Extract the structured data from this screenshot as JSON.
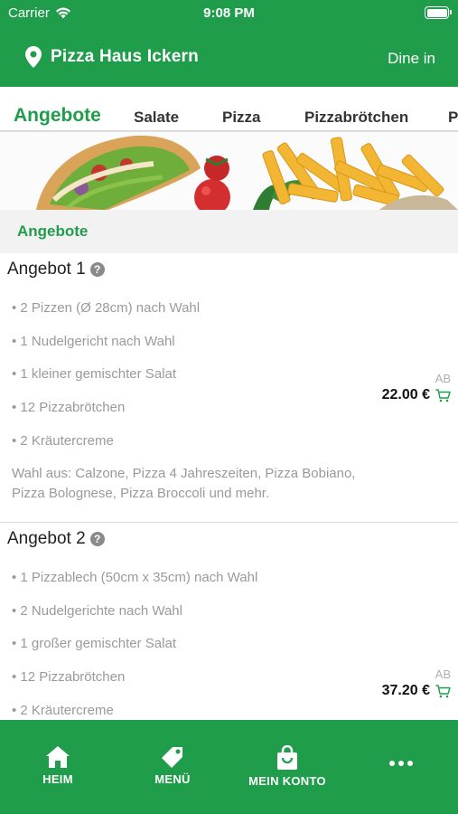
{
  "status_bar": {
    "carrier": "Carrier",
    "time": "9:08 PM"
  },
  "header": {
    "restaurant_name": "Pizza Haus Ickern",
    "mode": "Dine in",
    "icon": "location-pin-icon"
  },
  "tabs": [
    {
      "label": "Angebote",
      "active": true
    },
    {
      "label": "Salate",
      "active": false
    },
    {
      "label": "Pizza",
      "active": false
    },
    {
      "label": "Pizzabrötchen",
      "active": false
    },
    {
      "label": "P",
      "active": false
    }
  ],
  "section": {
    "title": "Angebote"
  },
  "offers": [
    {
      "name": "Angebot 1",
      "items": [
        "• 2 Pizzen (Ø 28cm) nach Wahl",
        "• 1 Nudelgericht nach Wahl",
        "• 1 kleiner gemischter Salat",
        "• 12 Pizzabrötchen",
        "• 2 Kräutercreme"
      ],
      "description": "Wahl aus: Calzone, Pizza 4 Jahreszeiten, Pizza Bobiano, Pizza Bolognese, Pizza Broccoli und mehr.",
      "price_prefix": "AB",
      "price": "22.00 €"
    },
    {
      "name": "Angebot 2",
      "items": [
        "• 1 Pizzablech (50cm x 35cm) nach Wahl",
        "• 2 Nudelgerichte nach Wahl",
        "• 1 großer gemischter Salat",
        "• 12 Pizzabrötchen",
        "• 2 Kräutercreme"
      ],
      "price_prefix": "AB",
      "price": "37.20 €"
    }
  ],
  "bottom_nav": [
    {
      "label": "HEIM",
      "icon": "home-icon"
    },
    {
      "label": "MENÜ",
      "icon": "tag-icon"
    },
    {
      "label": "MEIN KONTO",
      "icon": "shopping-bag-icon"
    },
    {
      "label": "",
      "icon": "more-dots-icon"
    }
  ],
  "colors": {
    "brand_green": "#1f9d4a",
    "muted_text": "#9a9a9a",
    "section_bg": "#f2f2f2"
  }
}
